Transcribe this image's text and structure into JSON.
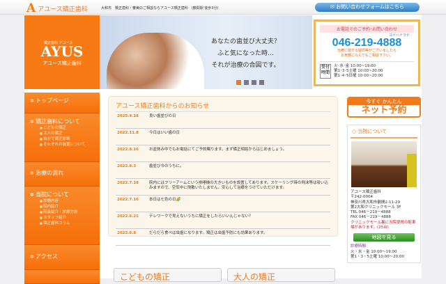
{
  "header": {
    "logo_mark": "A",
    "logo_text": "アユース矯正歯科",
    "tagline": "大和市　矯正歯科・審美のご相談ならアユース矯正歯科　(鶴間駅 徒歩3分)",
    "contact": "✉ お問い合わせフォームはこちら"
  },
  "brand": {
    "top": "矯正歯科 アユース",
    "logo": "AYUS",
    "name": "アユース矯正歯科"
  },
  "hero": {
    "lines": [
      "あなたの歯並び大丈夫？",
      "ふと気になった時…",
      "それが治療の合図です。"
    ],
    "slides": 4,
    "active_slide": 1
  },
  "phone": {
    "label": "お電話でのご予約･お問い合わせ",
    "kana": "ヨイハナラビ",
    "number": "046-219-4888",
    "msg1": "治療に関する疑問等がございましたら",
    "msg2": "お気軽になんでもご相談下さい。",
    "hours_label": "受付時間",
    "hours": [
      "火･水･金 10:00~19:00",
      "第1･3･5土曜 10:00~20:00",
      "第1･4･5日曜 10:00~20:00"
    ]
  },
  "nav": [
    {
      "label": "トップページ",
      "subs": []
    },
    {
      "label": "矯正歯科について",
      "subs": [
        "こどもの矯正",
        "大人の矯正",
        "自分で矯正診断",
        "それぞれの装置について"
      ]
    },
    {
      "label": "治療の流れ",
      "subs": []
    },
    {
      "label": "当院について",
      "subs": [
        "診療内容",
        "院内紹介",
        "院長紹介・診療方針",
        "スタッフ紹介",
        "矯正歯科コラム"
      ]
    },
    {
      "label": "アクセス",
      "subs": []
    }
  ],
  "news": {
    "title": "アユース矯正歯科からのお知らせ",
    "items": [
      {
        "date": "2025.4.18",
        "text": "良い歯並びの日"
      },
      {
        "date": "2022.11.8",
        "text": "今日はいい歯の日"
      },
      {
        "date": "2022.8.16",
        "text": "お盆休み中でもお電話にてご予約賜ります。まず矯正相談からはじめましょう。"
      },
      {
        "date": "2022.8.3",
        "text": "歯並び今のうちに。"
      },
      {
        "date": "2022.7.18",
        "text": "院内にはフリーアームという排唾機の大きいものを設置してあります。スケーリング時の飛沫等は吸い込みますので、空気中に飛散いたしません。安心して治療をうけていただけます。"
      },
      {
        "date": "2022.7.16",
        "text": "本日は七色の日🌈"
      },
      {
        "date": "2022.6.21",
        "text": "テレワークで見えないうちに矯正をしたらいいんじゃない？"
      },
      {
        "date": "2022.6.8",
        "text": "だらだら食べは虫歯になります。矯正は虫歯予防にも効果あります。"
      }
    ]
  },
  "cards": [
    "こどもの矯正",
    "大人の矯正"
  ],
  "right": {
    "net_top": "今すぐ かんたん",
    "net_main": "ネット予約",
    "about_title": "当院について",
    "addr": [
      "アユース矯正歯科",
      "〒242-0004",
      "神奈川県大和市鶴間2-11-29",
      "第2大和クリニックモール 3F",
      "TEL 046－219－4888",
      "FAX 046－219－4888"
    ],
    "parking": "クリニックモール裏に当院提携の駐車場があります。(25台)",
    "map": "地図を見る",
    "hours_title": "診療時間",
    "hours": [
      "火・水・金 10:00〜19:00",
      "第1・3・5土曜 10:00〜20:00"
    ]
  }
}
